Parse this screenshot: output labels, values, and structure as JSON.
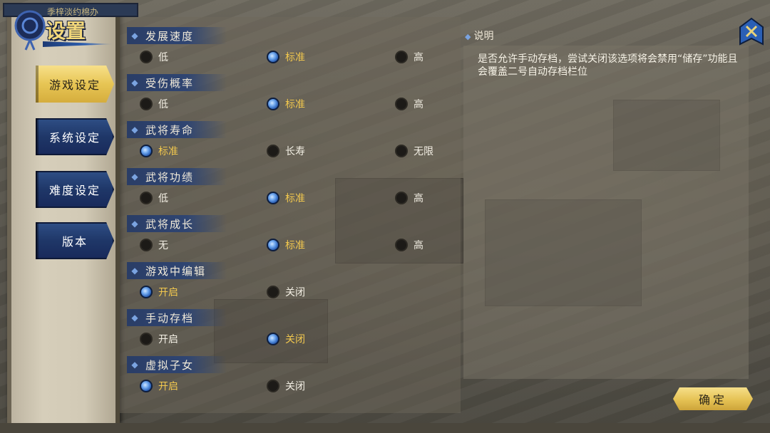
{
  "window": {
    "title": "设置",
    "top_strip_text": "季梓淡约棉办"
  },
  "sidebar": {
    "items": [
      {
        "label": "游戏设定",
        "active": true
      },
      {
        "label": "系统设定",
        "active": false
      },
      {
        "label": "难度设定",
        "active": false
      },
      {
        "label": "版本",
        "active": false
      }
    ]
  },
  "settings": [
    {
      "label": "发展速度",
      "options": [
        "低",
        "标准",
        "高"
      ],
      "selected": 1
    },
    {
      "label": "受伤概率",
      "options": [
        "低",
        "标准",
        "高"
      ],
      "selected": 1
    },
    {
      "label": "武将寿命",
      "options": [
        "标准",
        "长寿",
        "无限"
      ],
      "selected": 0
    },
    {
      "label": "武将功绩",
      "options": [
        "低",
        "标准",
        "高"
      ],
      "selected": 1
    },
    {
      "label": "武将成长",
      "options": [
        "无",
        "标准",
        "高"
      ],
      "selected": 1
    },
    {
      "label": "游戏中编辑",
      "options": [
        "开启",
        "关闭"
      ],
      "selected": 0
    },
    {
      "label": "手动存档",
      "options": [
        "开启",
        "关闭"
      ],
      "selected": 1
    },
    {
      "label": "虚拟子女",
      "options": [
        "开启",
        "关闭"
      ],
      "selected": 0
    }
  ],
  "description": {
    "title": "说明",
    "text": "是否允许手动存档，尝试关闭该选项将会禁用“储存”功能且会覆盖二号自动存档栏位"
  },
  "confirm_label": "确定",
  "icons": {
    "close": "close-icon",
    "knot": "knot-ornament-icon",
    "diamond": "diamond-icon"
  },
  "colors": {
    "accent_gold": "#f2c84e",
    "nav_blue": "#1f3768",
    "radio_on": "#6ea7ee"
  }
}
